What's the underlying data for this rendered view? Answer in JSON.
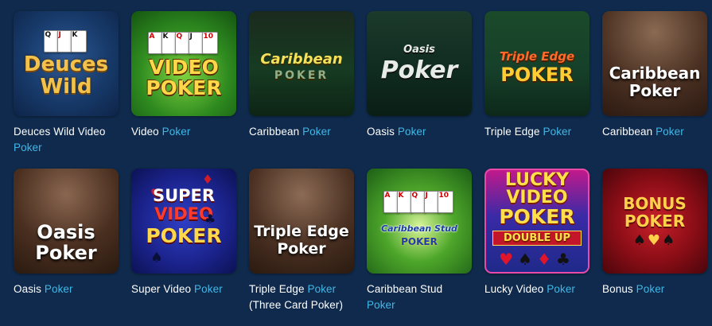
{
  "games": [
    {
      "thumb_text": [
        "Deuces",
        "Wild"
      ],
      "title_plain": "Deuces Wild Video",
      "title_hl": "Poker"
    },
    {
      "thumb_text": [
        "VIDEO",
        "POKER"
      ],
      "title_plain": "Video",
      "title_hl": "Poker"
    },
    {
      "thumb_text": [
        "Caribbean",
        "POKER"
      ],
      "title_plain": "Caribbean",
      "title_hl": "Poker"
    },
    {
      "thumb_text": [
        "Oasis",
        "Poker"
      ],
      "title_plain": "Oasis",
      "title_hl": "Poker"
    },
    {
      "thumb_text": [
        "Triple Edge",
        "POKER"
      ],
      "title_plain": "Triple Edge",
      "title_hl": "Poker"
    },
    {
      "thumb_text": [
        "Caribbean",
        "Poker"
      ],
      "title_plain": "Caribbean",
      "title_hl": "Poker"
    },
    {
      "thumb_text": [
        "Oasis",
        "Poker"
      ],
      "title_plain": "Oasis",
      "title_hl": "Poker"
    },
    {
      "thumb_text": [
        "SUPER",
        "VIDEO",
        "POKER"
      ],
      "title_plain": "Super Video",
      "title_hl": "Poker"
    },
    {
      "thumb_text": [
        "Triple Edge",
        "Poker"
      ],
      "title_plain": "Triple Edge",
      "title_hl": "Poker",
      "title_suffix": "(Three Card Poker)"
    },
    {
      "thumb_text": [
        "Caribbean Stud",
        "POKER"
      ],
      "title_plain": "Caribbean Stud",
      "title_hl": "Poker"
    },
    {
      "thumb_text": [
        "LUCKY",
        "VIDEO",
        "POKER",
        "DOUBLE UP"
      ],
      "title_plain": "Lucky Video",
      "title_hl": "Poker"
    },
    {
      "thumb_text": [
        "BONUS",
        "POKER"
      ],
      "title_plain": "Bonus",
      "title_hl": "Poker"
    }
  ],
  "colors": {
    "background": "#0f2a4c",
    "title_text": "#ffffff",
    "title_highlight": "#3fb8e8"
  },
  "card_glyphs": {
    "royal": [
      "10",
      "J",
      "Q",
      "K",
      "A"
    ],
    "suit_heart": "♥",
    "suit_spade": "♠",
    "suit_diamond": "♦",
    "suit_club": "♣"
  }
}
